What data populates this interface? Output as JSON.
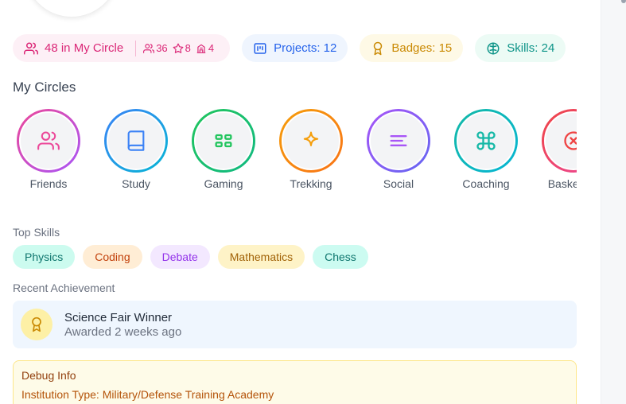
{
  "stats": {
    "circle_label": "48 in My Circle",
    "mini": [
      {
        "icon": "users-icon",
        "value": "36"
      },
      {
        "icon": "star-icon",
        "value": "8"
      },
      {
        "icon": "building-icon",
        "value": "4"
      }
    ],
    "projects_label": "Projects: 12",
    "badges_label": "Badges: 15",
    "skills_label": "Skills: 24"
  },
  "my_circles": {
    "title": "My Circles",
    "items": [
      {
        "label": "Friends",
        "icon": "users-icon",
        "ring": [
          "#ec4899",
          "#a855f7"
        ],
        "color": "#ec4899"
      },
      {
        "label": "Study",
        "icon": "book-icon",
        "ring": [
          "#3b82f6",
          "#06b6d4"
        ],
        "color": "#3b82f6"
      },
      {
        "label": "Gaming",
        "icon": "grid-icon",
        "ring": [
          "#22c55e",
          "#10b981"
        ],
        "color": "#22c55e"
      },
      {
        "label": "Trekking",
        "icon": "sparkle-icon",
        "ring": [
          "#f59e0b",
          "#f97316"
        ],
        "color": "#f59e0b"
      },
      {
        "label": "Social",
        "icon": "lines-icon",
        "ring": [
          "#a855f7",
          "#6366f1"
        ],
        "color": "#a855f7"
      },
      {
        "label": "Coaching",
        "icon": "command-icon",
        "ring": [
          "#14b8a6",
          "#06b6d4"
        ],
        "color": "#14b8a6"
      },
      {
        "label": "Basketball",
        "icon": "x-circle-icon",
        "ring": [
          "#ef4444",
          "#ec4899"
        ],
        "color": "#ef4444"
      }
    ]
  },
  "top_skills": {
    "title": "Top Skills",
    "items": [
      {
        "label": "Physics",
        "bg": "#ccfbef",
        "fg": "#0f766e"
      },
      {
        "label": "Coding",
        "bg": "#ffedd5",
        "fg": "#c2410c"
      },
      {
        "label": "Debate",
        "bg": "#f3e8ff",
        "fg": "#9333ea"
      },
      {
        "label": "Mathematics",
        "bg": "#fef3c7",
        "fg": "#a16207"
      },
      {
        "label": "Chess",
        "bg": "#ccfbf1",
        "fg": "#0f766e"
      }
    ]
  },
  "recent_achievement": {
    "title": "Recent Achievement",
    "name": "Science Fair Winner",
    "subtitle": "Awarded 2 weeks ago",
    "icon": "award-icon"
  },
  "debug": {
    "title": "Debug Info",
    "institution": "Institution Type: Military/Defense Training Academy"
  }
}
